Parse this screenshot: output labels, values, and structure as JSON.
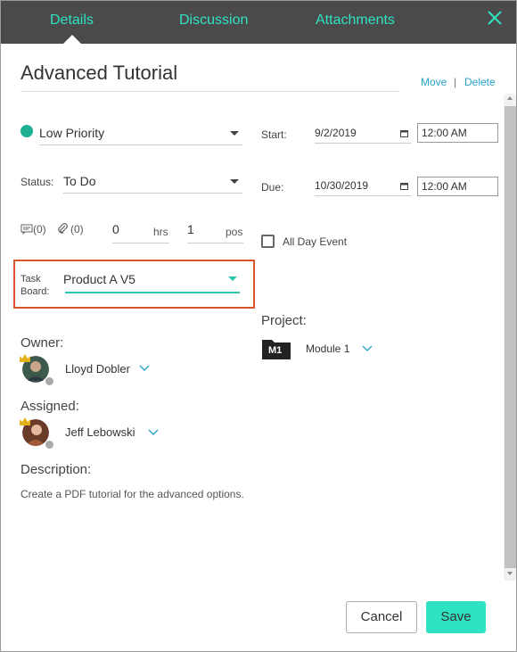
{
  "tabs": [
    {
      "label": "Details",
      "active": true
    },
    {
      "label": "Discussion",
      "active": false
    },
    {
      "label": "Attachments",
      "active": false
    }
  ],
  "task": {
    "title": "Advanced Tutorial"
  },
  "actions": {
    "move_label": "Move",
    "separator": "|",
    "delete_label": "Delete"
  },
  "priority": {
    "value": "Low Priority",
    "color": "#1fb094"
  },
  "status": {
    "label": "Status:",
    "value": "To Do"
  },
  "counts": {
    "comments": "(0)",
    "attachments": "(0)"
  },
  "estimate": {
    "hours_value": "0",
    "hours_unit": "hrs",
    "pos_value": "1",
    "pos_unit": "pos"
  },
  "taskboard": {
    "label_line1": "Task",
    "label_line2": "Board:",
    "value": "Product A V5"
  },
  "dates": {
    "start_label": "Start:",
    "start_date": "9/2/2019",
    "start_time": "12:00 AM",
    "due_label": "Due:",
    "due_date": "10/30/2019",
    "due_time": "12:00 AM",
    "all_day_label": "All Day Event"
  },
  "project": {
    "label": "Project:",
    "badge": "M1",
    "name": "Module 1"
  },
  "owner": {
    "label": "Owner:",
    "name": "Lloyd Dobler"
  },
  "assigned": {
    "label": "Assigned:",
    "name": "Jeff Lebowski"
  },
  "description": {
    "label": "Description:",
    "text": "Create a PDF tutorial for the advanced options."
  },
  "buttons": {
    "cancel": "Cancel",
    "save": "Save"
  },
  "colors": {
    "accent": "#2fe3c2",
    "header_bg": "#4a4a4a",
    "link": "#29a3c8",
    "highlight_border": "#d9532c"
  }
}
